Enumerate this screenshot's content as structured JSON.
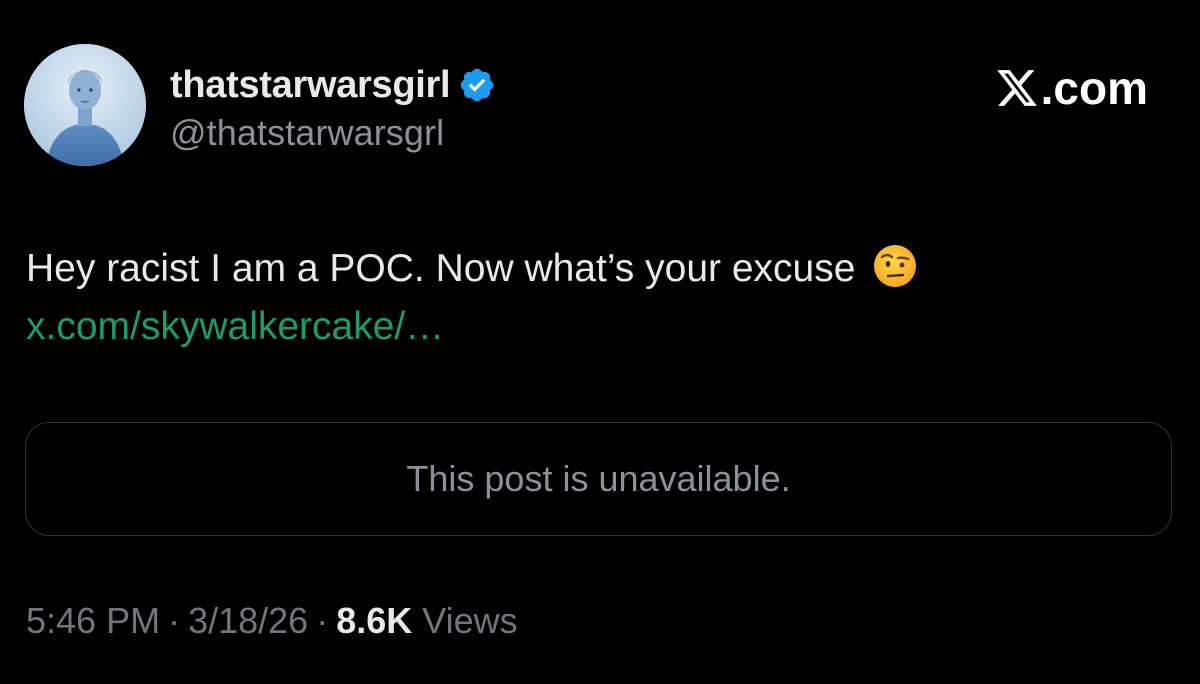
{
  "user": {
    "display_name": "thatstarwarsgirl",
    "handle": "@thatstarwarsgrl",
    "verified": true
  },
  "brand": {
    "label": ".com",
    "icon": "x-logo-icon"
  },
  "post": {
    "text": "Hey racist I am a POC. Now what’s your excuse",
    "emoji": "face-with-raised-eyebrow-icon",
    "link": "x.com/skywalkercake/…"
  },
  "quote": {
    "unavailable_text": "This post is unavailable."
  },
  "meta": {
    "time": "5:46 PM",
    "separator": "·",
    "date": "3/18/26",
    "views_count": "8.6K",
    "views_label": "Views"
  },
  "colors": {
    "background": "#000000",
    "link": "#1d9b6a",
    "verified_badge": "#1d9bf0",
    "secondary_text": "#71767b"
  }
}
